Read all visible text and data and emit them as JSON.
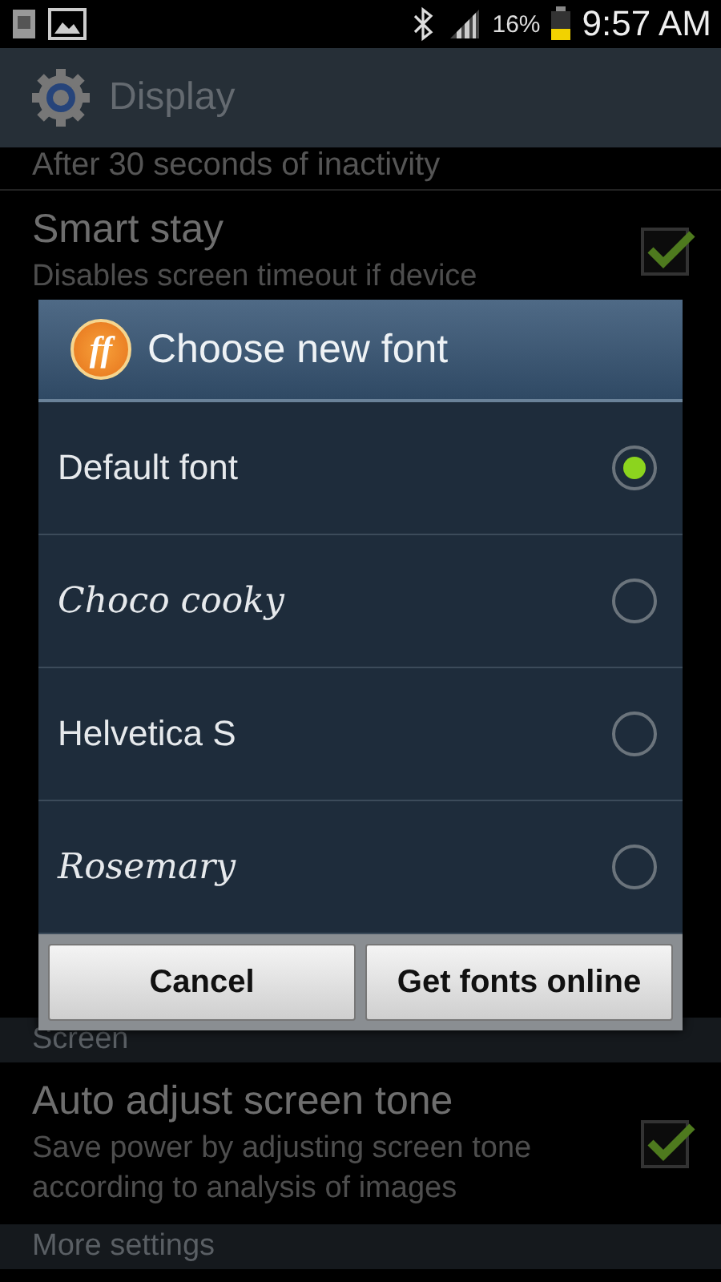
{
  "status_bar": {
    "battery": "16%",
    "time": "9:57 AM"
  },
  "header": {
    "title": "Display"
  },
  "settings_above": [
    {
      "kind": "note",
      "text": "After 30 seconds of inactivity"
    },
    {
      "kind": "checkbox",
      "title": "Smart stay",
      "summary": "Disables screen timeout if device",
      "checked": true
    }
  ],
  "dialog": {
    "logo": "ff",
    "title": "Choose new font",
    "options": [
      {
        "label": "Default font",
        "kind": "plain",
        "selected": true
      },
      {
        "label": "Choco cooky",
        "kind": "script",
        "selected": false
      },
      {
        "label": "Helvetica S",
        "kind": "plain",
        "selected": false
      },
      {
        "label": "Rosemary",
        "kind": "script",
        "selected": false
      }
    ],
    "buttons": [
      "Cancel",
      "Get fonts online"
    ]
  },
  "settings_below": [
    {
      "kind": "section",
      "text": "Screen"
    },
    {
      "kind": "checkbox",
      "title": "Auto adjust screen tone",
      "summary": "Save power by adjusting screen tone according to analysis of images",
      "checked": true
    },
    {
      "kind": "section",
      "text": "More settings"
    }
  ]
}
